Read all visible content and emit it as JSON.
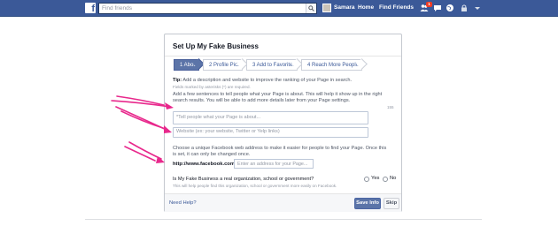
{
  "topbar": {
    "search_placeholder": "Find friends",
    "user_name": "Samara",
    "home_label": "Home",
    "find_friends_label": "Find Friends",
    "notification_count": "1",
    "colors": {
      "bar": "#3b5998",
      "badge": "#f03d25"
    }
  },
  "card": {
    "title": "Set Up My Fake Business",
    "steps": [
      {
        "label": "1 About",
        "active": true
      },
      {
        "label": "2 Profile Picture",
        "active": false
      },
      {
        "label": "3 Add to Favorites",
        "active": false
      },
      {
        "label": "4 Reach More People",
        "active": false
      }
    ],
    "tip_label": "Tip:",
    "tip_text": " Add a description and website to improve the ranking of your Page in search.",
    "required_note": "Fields marked by asterisks (*) are required.",
    "about_paragraph_line1": "Add a few sentences to tell people what your Page is about. This will help it show up in the right",
    "about_paragraph_line2": "search results. You will be able to add more details later from your Page settings.",
    "char_counter": "155",
    "about_placeholder": "*Tell people what your Page is about...",
    "website_placeholder": "Website (ex: your website, Twitter or Yelp links)",
    "address_paragraph_line1": "Choose a unique Facebook web address to make it easier for people to find your Page. Once this",
    "address_paragraph_line2": "is set, it can only be changed once.",
    "url_prefix": "http://www.facebook.com/",
    "address_placeholder": "Enter an address for your Page...",
    "question": "Is My Fake Business a real organization, school or government?",
    "question_help": "This will help people find this organization, school or government more easily on Facebook.",
    "yes_label": "Yes",
    "no_label": "No",
    "help_link": "Need Help?",
    "save_label": "Save Info",
    "skip_label": "Skip",
    "colors": {
      "accent": "#5b74a8",
      "link": "#3b5998",
      "annotation": "#e8288c"
    }
  }
}
